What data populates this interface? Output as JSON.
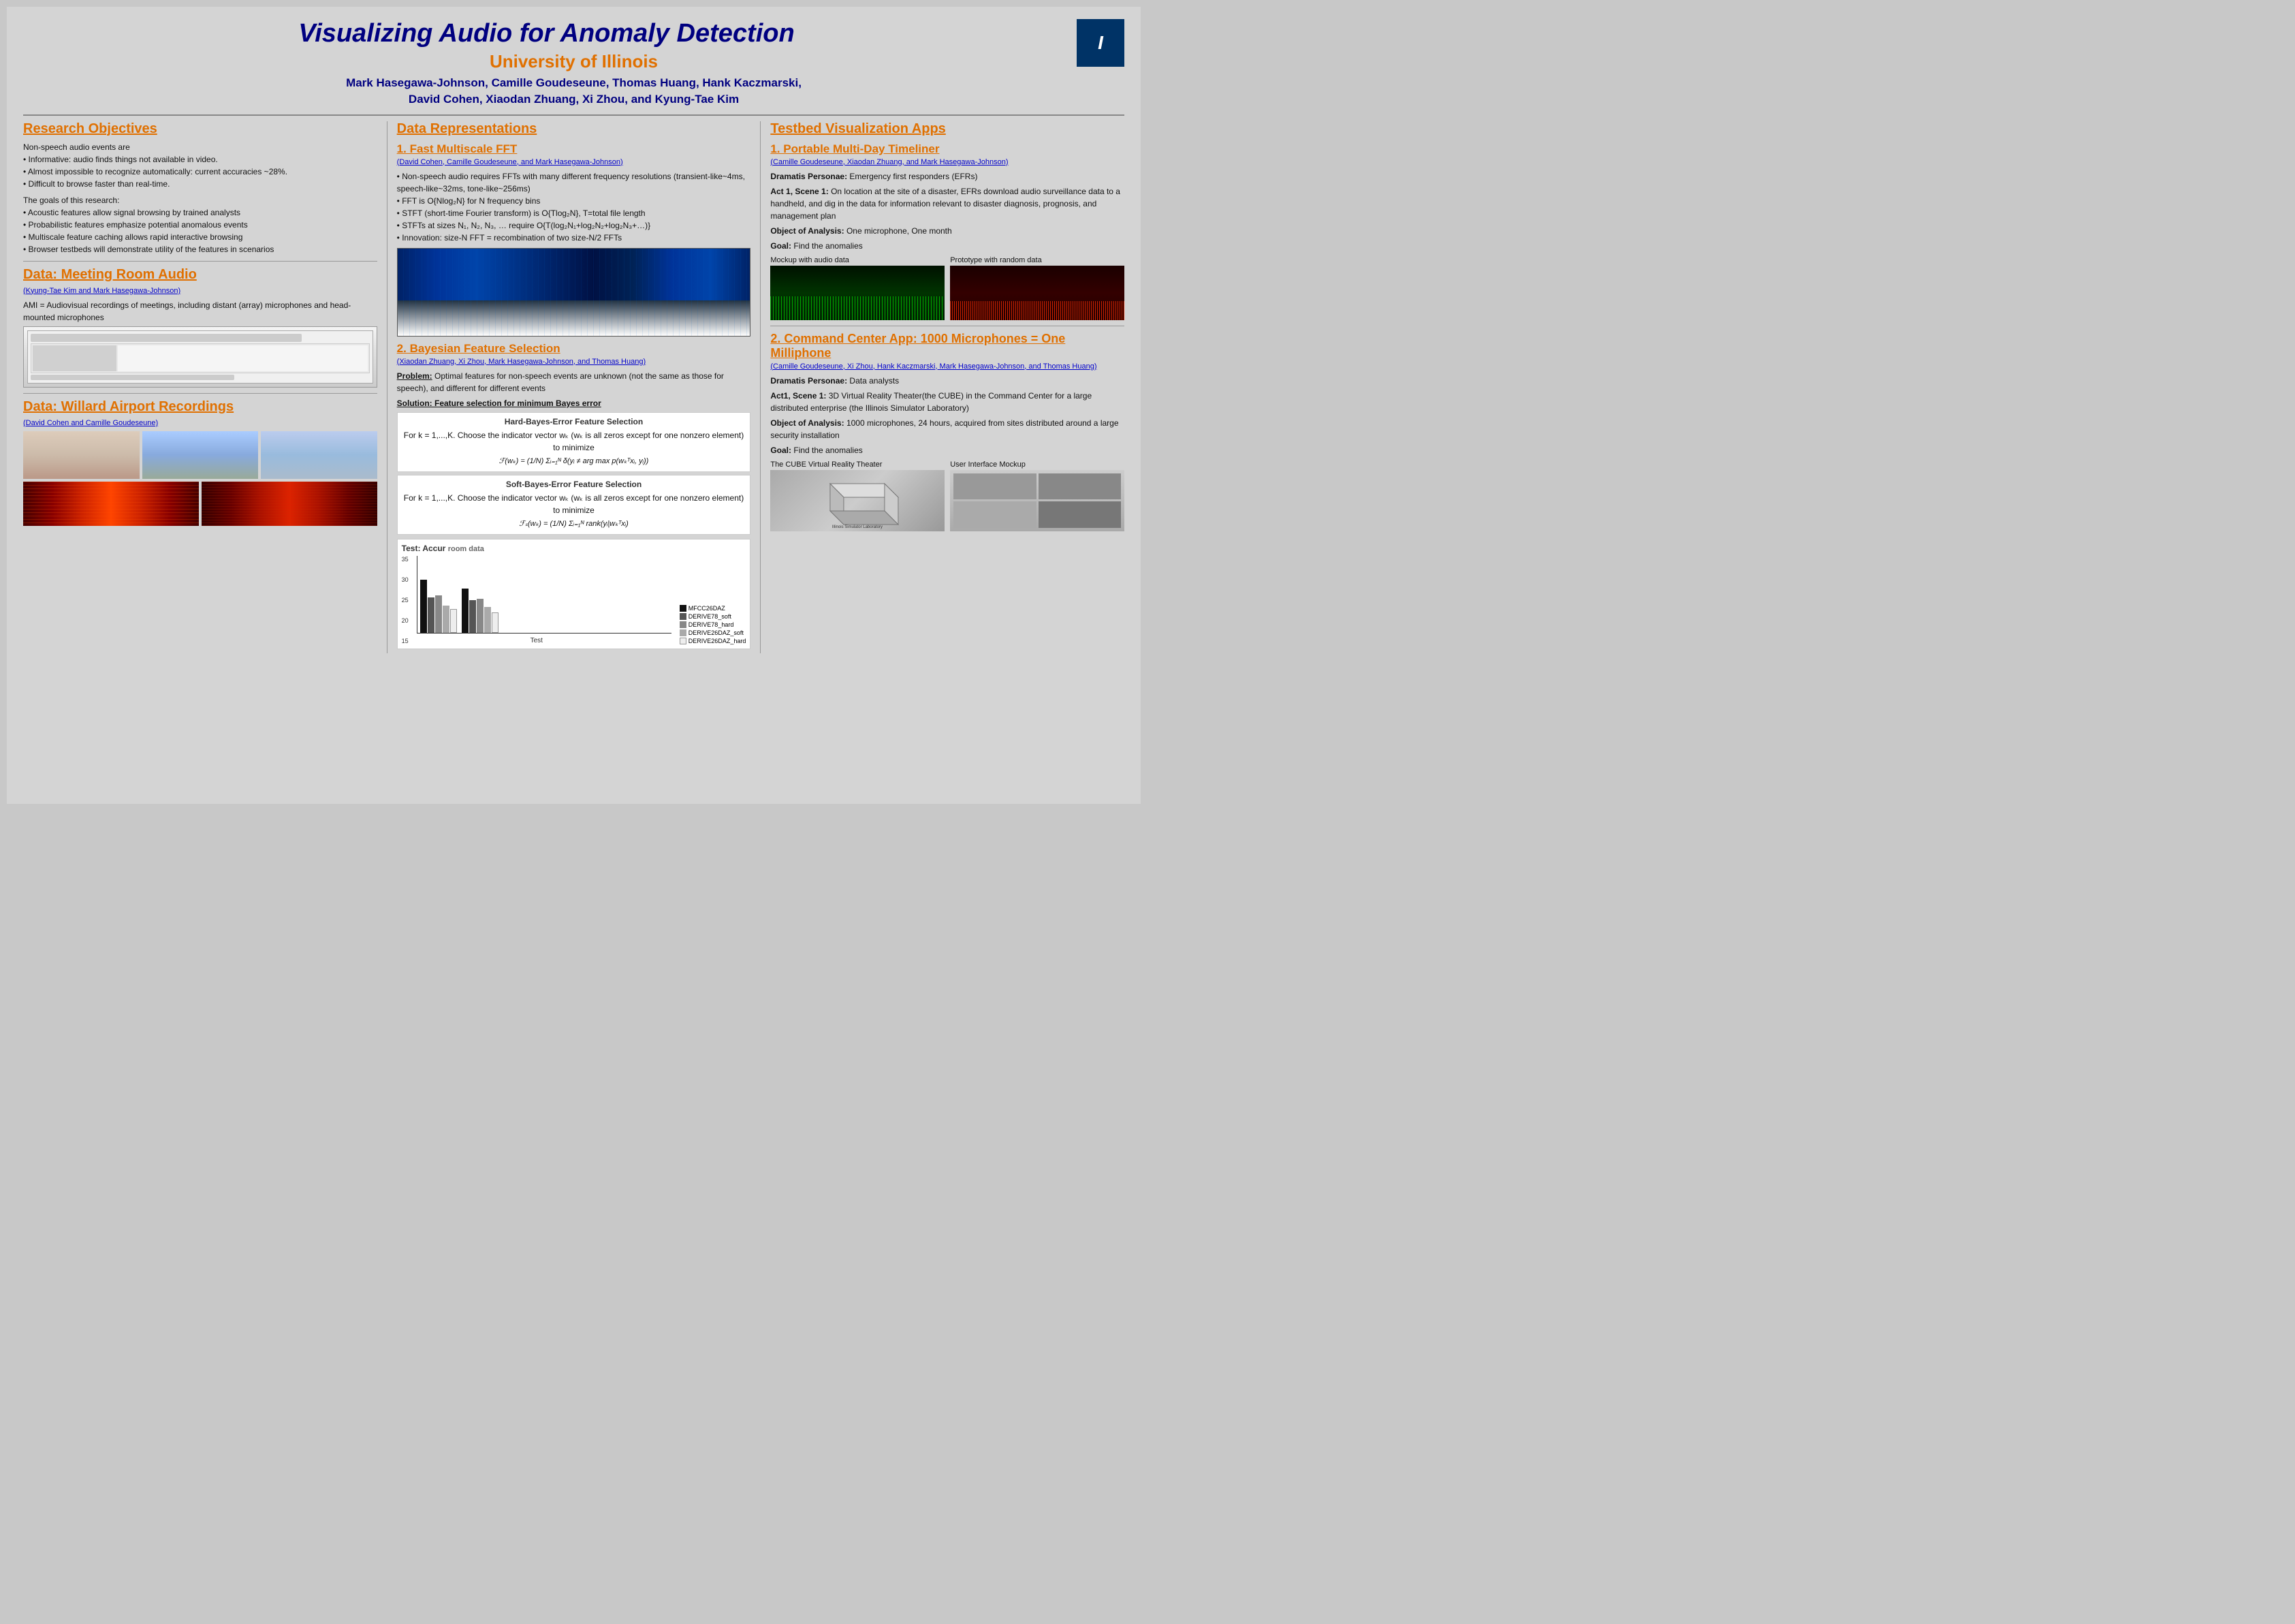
{
  "poster": {
    "main_title": "Visualizing Audio for Anomaly Detection",
    "university": "University of Illinois",
    "authors_line1": "Mark Hasegawa-Johnson, Camille Goudeseune, Thomas Huang, Hank Kaczmarski,",
    "authors_line2": "David Cohen, Xiaodan Zhuang, Xi Zhou, and Kyung-Tae Kim"
  },
  "col1": {
    "research_heading": "Research Objectives",
    "research_body1": "Non-speech audio events are",
    "research_bullets": [
      "Informative: audio finds things not available in video.",
      "Almost impossible to recognize automatically: current accuracies ~28%.",
      "Difficult to browse faster than real-time."
    ],
    "research_goals_intro": "The goals of this research:",
    "research_goals": [
      "Acoustic features allow signal browsing by trained analysts",
      "Probabilistic features emphasize potential anomalous events",
      "Multiscale feature caching allows rapid interactive browsing",
      "Browser testbeds will demonstrate utility of the features in scenarios"
    ],
    "meeting_heading": "Data: Meeting Room Audio",
    "meeting_subauthors": "(Kyung-Tae Kim and Mark Hasegawa-Johnson)",
    "meeting_body": "AMI = Audiovisual recordings of meetings, including distant (array) microphones and head-mounted microphones",
    "airport_heading": "Data: Willard Airport Recordings",
    "airport_subauthors": "(David Cohen and Camille Goudeseune)"
  },
  "col2": {
    "data_heading": "Data Representations",
    "fft_heading": "1. Fast Multiscale FFT",
    "fft_subauthors": "(David Cohen, Camille Goudeseune, and Mark Hasegawa-Johnson)",
    "fft_bullets": [
      "Non-speech audio requires FFTs with many different frequency resolutions (transient-like~4ms, speech-like~32ms, tone-like~256ms)",
      "FFT is O{Nlog₂N} for N frequency bins",
      "STFT (short-time Fourier transform) is O{Tlog₂N}, T=total file length",
      "STFTs at sizes N₁, N₂, N₃, … require O{T(log₂N₁+log₂N₂+log₂N₃+…)}",
      "Innovation: size-N FFT = recombination of two size-N/2 FFTs"
    ],
    "bayesian_heading": "2. Bayesian Feature Selection",
    "bayesian_subauthors": "(Xiaodan Zhuang, Xi Zhou, Mark Hasegawa-Johnson, and Thomas Huang)",
    "problem_label": "Problem:",
    "problem_text": "Optimal features for non-speech events are unknown (not the same as those for speech), and different for different events",
    "solution_label": "Solution: Feature selection for minimum Bayes error",
    "hard_bayes_title": "Hard-Bayes-Error Feature Selection",
    "hard_bayes_desc": "For k = 1,...,K. Choose the indicator vector wₖ (wₖ is all zeros except for one nonzero element) to minimize",
    "hard_bayes_formula": "ℱ(wₖ) = (1/N) Σᵢ₌₁ᴺ δ(yᵢ ≠ arg max p(wₖᵀxᵢ, yᵢ))",
    "soft_bayes_title": "Soft-Bayes-Error Feature Selection",
    "soft_bayes_desc": "For k = 1,...,K. Choose the indicator vector wₖ (wₖ is all zeros except for one nonzero element) to minimize",
    "soft_bayes_formula": "ℱₛ(wₖ) = (1/N) Σᵢ₌₁ᴺ rank(yᵢ|wₖᵀxᵢ)",
    "chart_title": "Test: Accur",
    "chart_xlabel": "Test",
    "chart_y_labels": [
      "35",
      "30",
      "25",
      "20",
      "15"
    ],
    "chart_legend": [
      {
        "label": "MFCC26DAZ",
        "color": "#111111"
      },
      {
        "label": "DERIVE78_soft",
        "color": "#555555"
      },
      {
        "label": "DERIVE78_hard",
        "color": "#888888"
      },
      {
        "label": "DERIVE26DAZ_soft",
        "color": "#aaaaaa"
      },
      {
        "label": "DERIVE26DAZ_hard",
        "color": "#eeeeee"
      }
    ],
    "room_data_label": "room data"
  },
  "col3": {
    "testbed_heading": "Testbed Visualization Apps",
    "timeliner_heading": "1. Portable Multi-Day Timeliner",
    "timeliner_subauthors": "(Camille Goudeseune, Xiaodan Zhuang, and Mark Hasegawa-Johnson)",
    "dramatis_label": "Dramatis Personae:",
    "dramatis_text": "Emergency first responders (EFRs)",
    "act1_label": "Act 1, Scene 1:",
    "act1_text": "On location at the site of a disaster, EFRs download audio surveillance data to a handheld, and dig in the data for information relevant to disaster diagnosis, prognosis, and management plan",
    "object_label": "Object of Analysis:",
    "object_text": "One microphone, One month",
    "goal_label": "Goal:",
    "goal_text": "Find the anomalies",
    "mockup_label": "Mockup with audio data",
    "prototype_label": "Prototype with random data",
    "command_heading": "2. Command Center App: 1000 Microphones = One Milliphone",
    "command_subauthors": "(Camille Goudeseune, Xi Zhou, Hank Kaczmarski, Mark Hasegawa-Johnson, and Thomas Huang)",
    "command_dramatis_label": "Dramatis Personae:",
    "command_dramatis_text": "Data analysts",
    "command_act1_label": "Act1, Scene 1:",
    "command_act1_text": "3D Virtual Reality Theater(the CUBE) in the Command Center for a large distributed enterprise (the Illinois Simulator Laboratory)",
    "command_object_label": "Object of Analysis:",
    "command_object_text": "1000 microphones, 24 hours, acquired from sites distributed around a large security installation",
    "command_goal_label": "Goal:",
    "command_goal_text": "Find the anomalies",
    "cube_label": "The CUBE Virtual Reality Theater",
    "ui_mockup_label": "User Interface Mockup"
  }
}
